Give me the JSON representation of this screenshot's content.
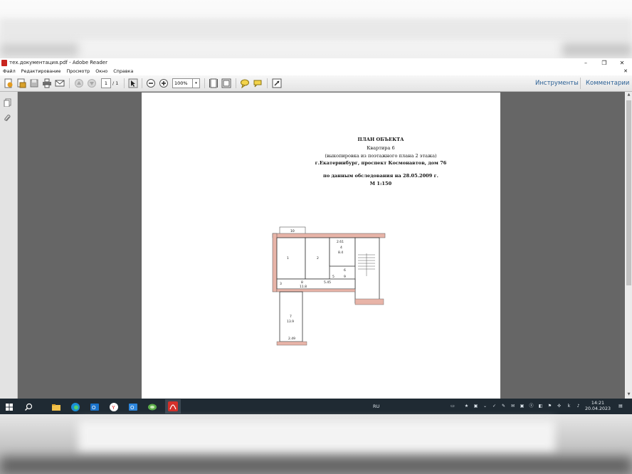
{
  "window": {
    "title": "тех.документация.pdf - Adobe Reader",
    "minimize": "–",
    "maximize": "❐",
    "close": "✕"
  },
  "menu": {
    "items": [
      "Файл",
      "Редактирование",
      "Просмотр",
      "Окно",
      "Справка"
    ],
    "doc_close": "✕"
  },
  "toolbar": {
    "page_current": "1",
    "page_total": "/ 1",
    "zoom": "100%",
    "zoom_arrow": "▾",
    "tools_label": "Инструменты",
    "comments_label": "Комментарии"
  },
  "document": {
    "heading": "ПЛАН ОБЪЕКТА",
    "line1": "Квартира 6",
    "line2": "(выкопировка из поэтажного плана 2 этажа)",
    "line3": "г.Екатеринбург, проспект Космонавтов, дом 76",
    "line4": "по данным обследования на 28.05.2009 г.",
    "line5": "М 1:150",
    "plan_labels": {
      "balcony_top": "10",
      "room1": "1",
      "room2": "2",
      "room3": "3",
      "room4": "4",
      "room5": "5",
      "room6": "6",
      "room7": "7",
      "room8": "8",
      "room9": "9",
      "area_kitchen": "8.4",
      "area_hall": "11.8",
      "area_room7": "13.9",
      "dim_top": "2.61",
      "dim_bottom": "2.49",
      "dim_mid": "5.45"
    }
  },
  "taskbar": {
    "lang": "RU",
    "time": "14:21",
    "date": "20.04.2023"
  },
  "colors": {
    "doc_bg": "#666666",
    "taskbar_bg": "#1f2a33",
    "link_blue": "#2a5f94",
    "wall_pink": "#e8b4a8"
  }
}
